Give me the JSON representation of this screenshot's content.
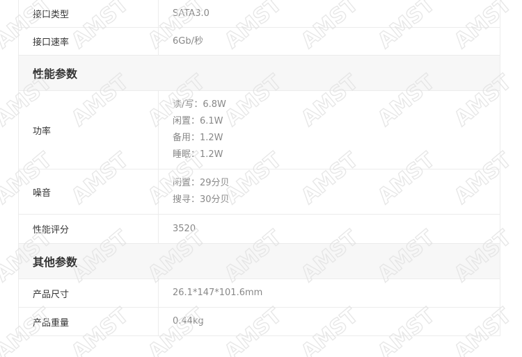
{
  "rows_top": [
    {
      "label": "接口类型",
      "values": [
        "SATA3.0"
      ]
    },
    {
      "label": "接口速率",
      "values": [
        "6Gb/秒"
      ]
    }
  ],
  "section_perf": {
    "title": "性能参数"
  },
  "perf_rows": [
    {
      "label": "功率",
      "values": [
        "读/写：6.8W",
        "闲置：6.1W",
        "备用：1.2W",
        "睡眠：1.2W"
      ]
    },
    {
      "label": "噪音",
      "values": [
        "闲置：29分贝",
        "搜寻：30分贝"
      ]
    },
    {
      "label": "性能评分",
      "values": [
        "3520"
      ]
    }
  ],
  "section_other": {
    "title": "其他参数"
  },
  "other_rows": [
    {
      "label": "产品尺寸",
      "values": [
        "26.1*147*101.6mm"
      ]
    },
    {
      "label": "产品重量",
      "values": [
        "0.44kg"
      ]
    }
  ],
  "watermark": {
    "text": "AMST"
  }
}
